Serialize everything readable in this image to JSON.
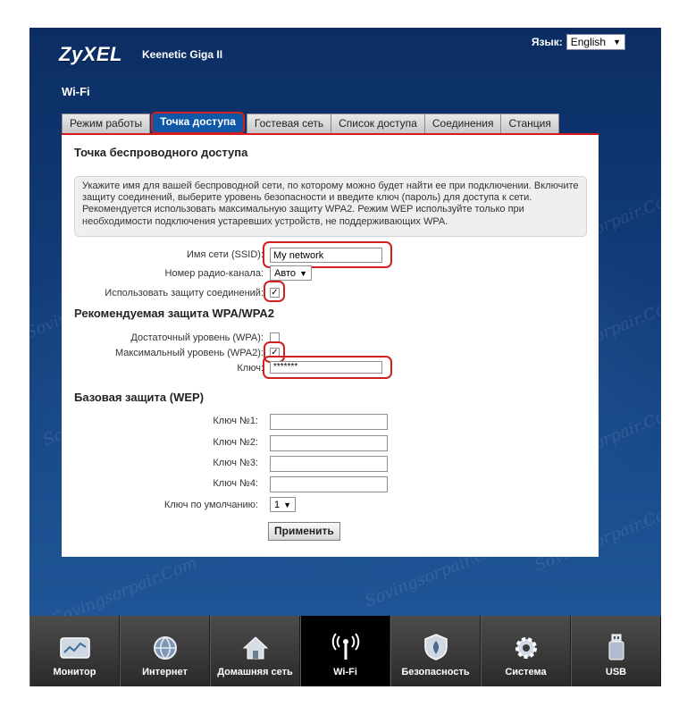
{
  "header": {
    "brand": "ZyXEL",
    "model": "Keenetic Giga II",
    "language_label": "Язык:",
    "language_value": "English",
    "page_title": "Wi-Fi"
  },
  "tabs": [
    {
      "label": "Режим работы"
    },
    {
      "label": "Точка доступа"
    },
    {
      "label": "Гостевая сеть"
    },
    {
      "label": "Список доступа"
    },
    {
      "label": "Соединения"
    },
    {
      "label": "Станция"
    }
  ],
  "section": {
    "title": "Точка беспроводного доступа",
    "info": "Укажите имя для вашей беспроводной сети, по которому можно будет найти ее при подключении. Включите защиту соединений, выберите уровень безопасности и введите ключ (пароль) для доступа к сети. Рекомендуется использовать максимальную защиту WPA2. Режим WEP используйте только при необходимости подключения устаревших устройств, не поддерживающих WPA."
  },
  "fields": {
    "ssid_label": "Имя сети (SSID):",
    "ssid_value": "My network",
    "channel_label": "Номер радио-канала:",
    "channel_value": "Авто",
    "protect_label": "Использовать защиту соединений:"
  },
  "wpa": {
    "title": "Рекомендуемая защита WPA/WPA2",
    "wpa_label": "Достаточный уровень (WPA):",
    "wpa2_label": "Максимальный уровень (WPA2):",
    "key_label": "Ключ:",
    "key_value": "*******"
  },
  "wep": {
    "title": "Базовая защита (WEP)",
    "key1_label": "Ключ №1:",
    "key2_label": "Ключ №2:",
    "key3_label": "Ключ №3:",
    "key4_label": "Ключ №4:",
    "default_label": "Ключ по умолчанию:",
    "default_value": "1"
  },
  "apply_label": "Применить",
  "taskbar": [
    {
      "label": "Монитор",
      "icon": "monitor-icon"
    },
    {
      "label": "Интернет",
      "icon": "globe-icon"
    },
    {
      "label": "Домашняя сеть",
      "icon": "home-icon"
    },
    {
      "label": "Wi-Fi",
      "icon": "wifi-icon"
    },
    {
      "label": "Безопасность",
      "icon": "shield-icon"
    },
    {
      "label": "Система",
      "icon": "gear-icon"
    },
    {
      "label": "USB",
      "icon": "usb-icon"
    }
  ],
  "colors": {
    "accent": "#d61a1a",
    "active_tab": "#0f58a7",
    "background": "#123d7a"
  }
}
